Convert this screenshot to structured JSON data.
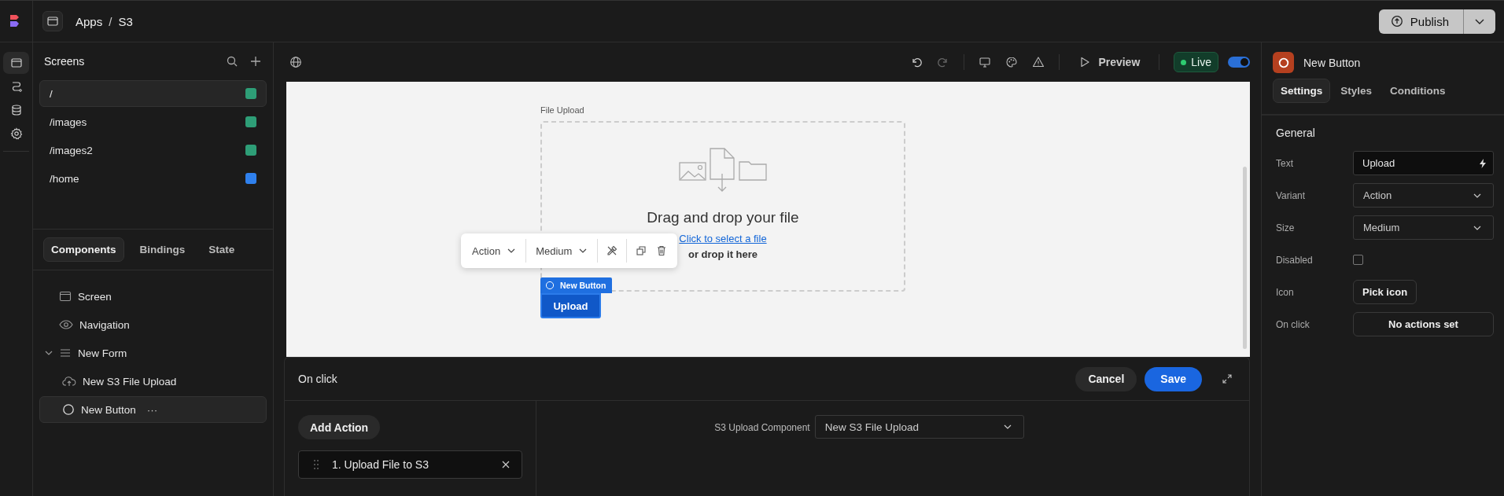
{
  "app_bar": {
    "breadcrumb": [
      "Apps",
      "S3"
    ],
    "separator": "/",
    "publish": "Publish"
  },
  "rail": [
    {
      "kind": "screens",
      "selected": true
    },
    {
      "kind": "automations",
      "selected": false
    },
    {
      "kind": "data",
      "selected": false
    },
    {
      "kind": "settings",
      "selected": false
    }
  ],
  "screens": {
    "title": "Screens",
    "items": [
      {
        "label": "/",
        "selected": true,
        "color": "#2e9e77"
      },
      {
        "label": "/images",
        "selected": false,
        "color": "#2e9e77"
      },
      {
        "label": "/images2",
        "selected": false,
        "color": "#2e9e77"
      },
      {
        "label": "/home",
        "selected": false,
        "color": "#2f80ed"
      }
    ]
  },
  "component_tabs": [
    {
      "label": "Components",
      "selected": true
    },
    {
      "label": "Bindings",
      "selected": false
    },
    {
      "label": "State",
      "selected": false
    }
  ],
  "tree": [
    {
      "label": "Screen",
      "kind": "screen",
      "selected": false
    },
    {
      "label": "Navigation",
      "kind": "navigation",
      "selected": false
    },
    {
      "label": "New Form",
      "kind": "form",
      "selected": false,
      "expanded": true,
      "children": [
        {
          "label": "New S3 File Upload",
          "kind": "upload",
          "selected": false
        },
        {
          "label": "New Button",
          "kind": "button",
          "selected": true,
          "more": "···"
        }
      ]
    }
  ],
  "toolbar": {
    "preview": "Preview",
    "live": "Live",
    "live_on": true
  },
  "canvas": {
    "upload": {
      "label": "File Upload",
      "title": "Drag and drop your file",
      "link": "Click to select a file",
      "hint": "or drop it here"
    },
    "floating_toolbar": {
      "variant": "Action",
      "size": "Medium"
    },
    "selection_tag": "New Button",
    "button": "Upload"
  },
  "action_panel": {
    "title": "On click",
    "cancel": "Cancel",
    "save": "Save",
    "add": "Add Action",
    "actions": [
      "1. Upload File to S3"
    ],
    "field_label": "S3 Upload Component",
    "field_value": "New S3 File Upload"
  },
  "inspector": {
    "title": "New Button",
    "tabs": [
      {
        "label": "Settings",
        "selected": true
      },
      {
        "label": "Styles",
        "selected": false
      },
      {
        "label": "Conditions",
        "selected": false
      }
    ],
    "section": "General",
    "fields": [
      {
        "label": "Text",
        "kind": "text",
        "value": "Upload"
      },
      {
        "label": "Variant",
        "kind": "select",
        "value": "Action"
      },
      {
        "label": "Size",
        "kind": "select",
        "value": "Medium"
      },
      {
        "label": "Disabled",
        "kind": "checkbox",
        "checked": false
      },
      {
        "label": "Icon",
        "kind": "button",
        "value": "Pick icon"
      },
      {
        "label": "On click",
        "kind": "wide",
        "value": "No actions set"
      }
    ]
  }
}
